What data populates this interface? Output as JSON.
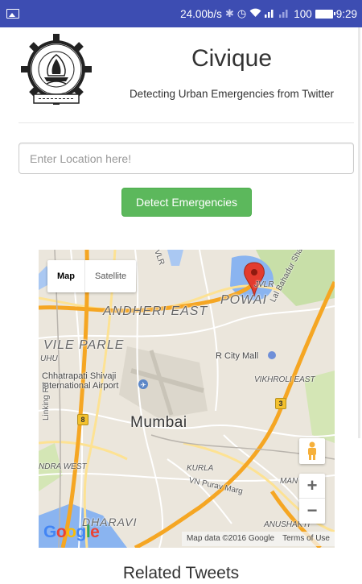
{
  "status_bar": {
    "net_speed": "24.00b/s",
    "battery": "100",
    "time": "9:29",
    "icons": [
      "image-icon",
      "bluetooth-icon",
      "alarm-icon",
      "wifi-icon",
      "signal-icon",
      "battery-icon"
    ]
  },
  "header": {
    "title": "Civique",
    "subtitle": "Detecting Urban Emergencies from Twitter"
  },
  "form": {
    "location_placeholder": "Enter Location here!",
    "location_value": "",
    "detect_button": "Detect Emergencies"
  },
  "map": {
    "map_type_options": [
      "Map",
      "Satellite"
    ],
    "selected_map_type": "Map",
    "zoom_in": "+",
    "zoom_out": "−",
    "attribution": "Map data ©2016 Google",
    "terms": "Terms of Use",
    "labels": {
      "powai": "POWAI",
      "andheri_east": "ANDHERI EAST",
      "vile_parle": "VILE PARLE",
      "r_city_mall": "R City Mall",
      "vikhroli_east": "VIKHROLI EAST",
      "airport": "Chhatrapati Shivaji\nInternational Airport",
      "mumbai": "Mumbai",
      "linking_rd": "Linking Rd",
      "kurla": "KURLA",
      "vn_purav_marg": "VN Purav Marg",
      "dharavi": "DHARAVI",
      "anushakti": "ANUSHAKTI",
      "andra_west": "NDRA WEST",
      "lal_bahadur": "Lal Bahadur Shastri Marg",
      "jvlr": "JVLR",
      "uhu": "UHU",
      "man": "MAN",
      "vlr": "VLR",
      "route_8": "8",
      "route_3": "3"
    },
    "google_logo": "Google"
  },
  "related_tweets_title": "Related Tweets",
  "colors": {
    "status_bar": "#3d4db2",
    "button": "#5cb85c",
    "water": "#7daef0",
    "highway": "#f5a623",
    "park": "#c8dfa8",
    "marker": "#e33b2e"
  }
}
